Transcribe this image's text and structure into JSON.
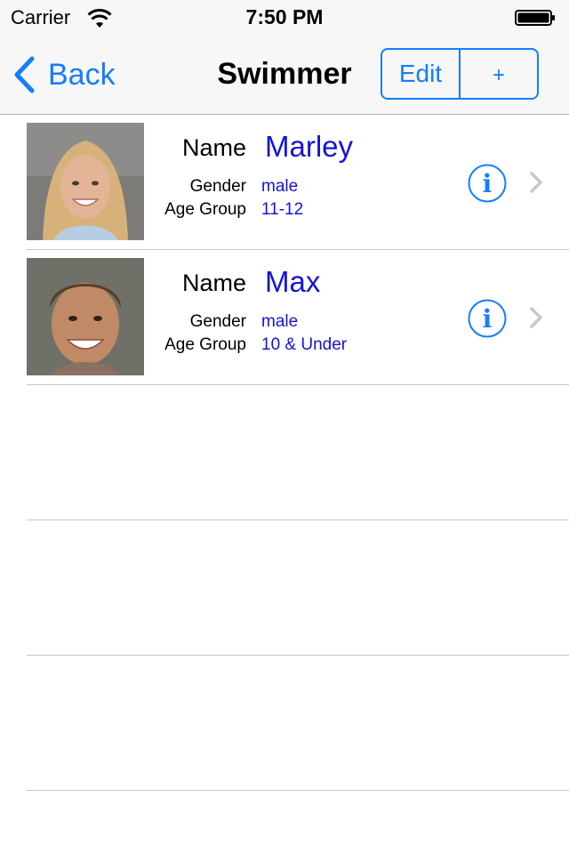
{
  "status_bar": {
    "carrier": "Carrier",
    "time": "7:50 PM"
  },
  "nav": {
    "back_label": "Back",
    "title": "Swimmer",
    "edit_label": "Edit",
    "add_label": "+"
  },
  "colors": {
    "tint": "#147efb",
    "value_text": "#1414d4",
    "separator": "#c8c7cc"
  },
  "labels": {
    "name": "Name",
    "gender": "Gender",
    "age_group": "Age Group"
  },
  "swimmers": [
    {
      "name": "Marley",
      "gender": "male",
      "age_group": "11-12",
      "photo": "girl-portrait"
    },
    {
      "name": "Max",
      "gender": "male",
      "age_group": "10 & Under",
      "photo": "boy-portrait"
    }
  ]
}
